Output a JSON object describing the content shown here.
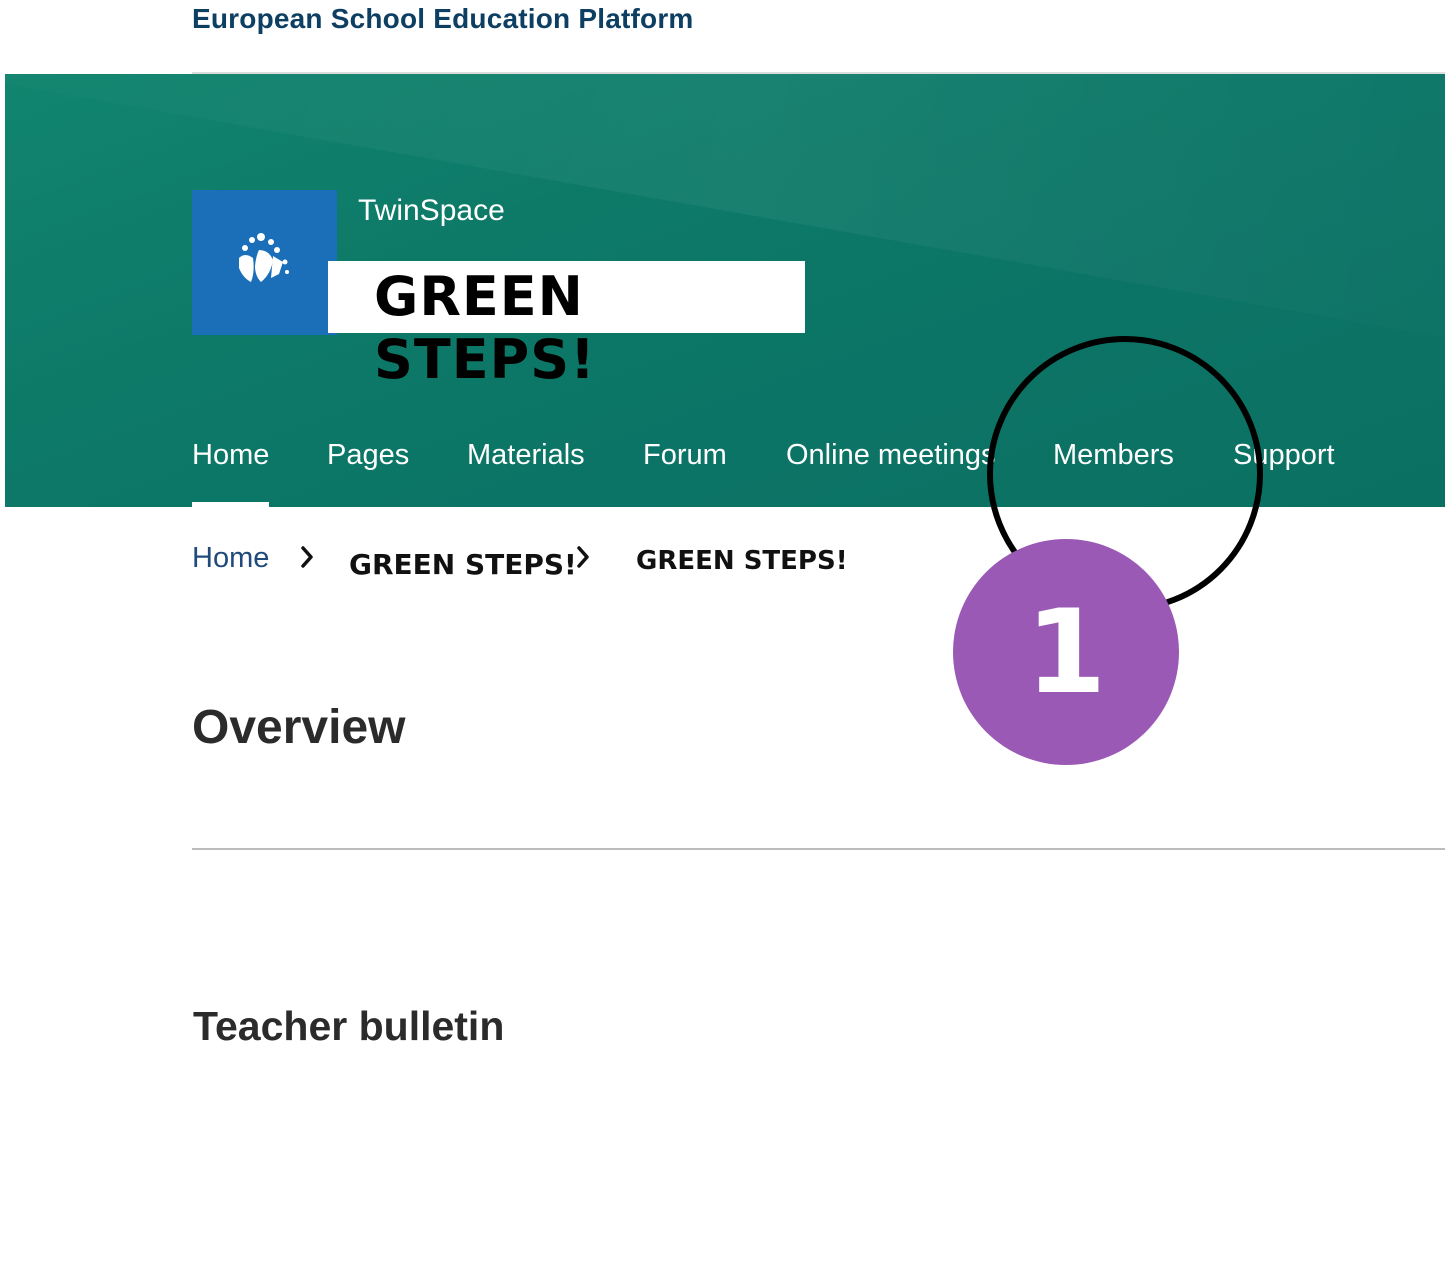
{
  "header": {
    "platform_title": "European School Education Platform"
  },
  "banner": {
    "logo_icon": "etwinning-logo-icon",
    "section_label": "TwinSpace",
    "project_title": "GREEN STEPS!"
  },
  "nav": {
    "items": [
      {
        "label": "Home",
        "active": true
      },
      {
        "label": "Pages"
      },
      {
        "label": "Materials"
      },
      {
        "label": "Forum"
      },
      {
        "label": "Online meetings"
      },
      {
        "label": "Members"
      },
      {
        "label": "Support"
      }
    ]
  },
  "breadcrumb": {
    "home": "Home",
    "level1": "GREEN STEPS!",
    "level2": "GREEN STEPS!",
    "separator_icon": "chevron-right-icon"
  },
  "main": {
    "overview_heading": "Overview",
    "bulletin_heading": "Teacher bulletin"
  },
  "annotation": {
    "badge_number": "1",
    "badge_color": "#9b59b6"
  },
  "colors": {
    "banner_green": "#0d7a68",
    "logo_blue": "#1a6fb8",
    "platform_title": "#0d3f63"
  }
}
